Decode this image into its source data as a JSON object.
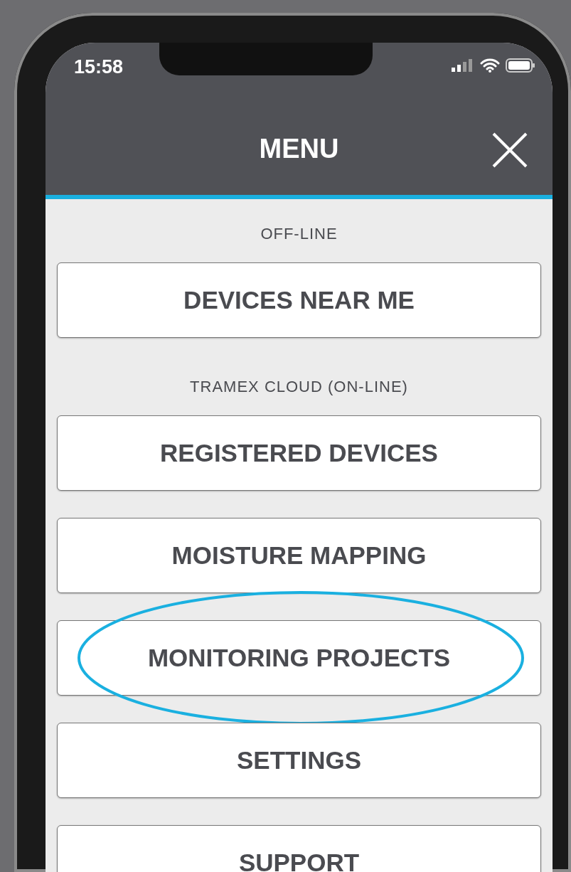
{
  "status_bar": {
    "time": "15:58"
  },
  "header": {
    "title": "MENU"
  },
  "items": [
    {
      "kind": "section_label",
      "text": "OFF-LINE"
    },
    {
      "kind": "button",
      "text": "DEVICES NEAR ME",
      "highlighted": false
    },
    {
      "kind": "section_label",
      "text": "TRAMEX CLOUD (ON-LINE)"
    },
    {
      "kind": "button",
      "text": "REGISTERED DEVICES",
      "highlighted": false
    },
    {
      "kind": "button",
      "text": "MOISTURE MAPPING",
      "highlighted": false
    },
    {
      "kind": "button",
      "text": "MONITORING PROJECTS",
      "highlighted": true
    },
    {
      "kind": "button",
      "text": "SETTINGS",
      "highlighted": false
    },
    {
      "kind": "button",
      "text": "SUPPORT",
      "highlighted": false
    }
  ]
}
